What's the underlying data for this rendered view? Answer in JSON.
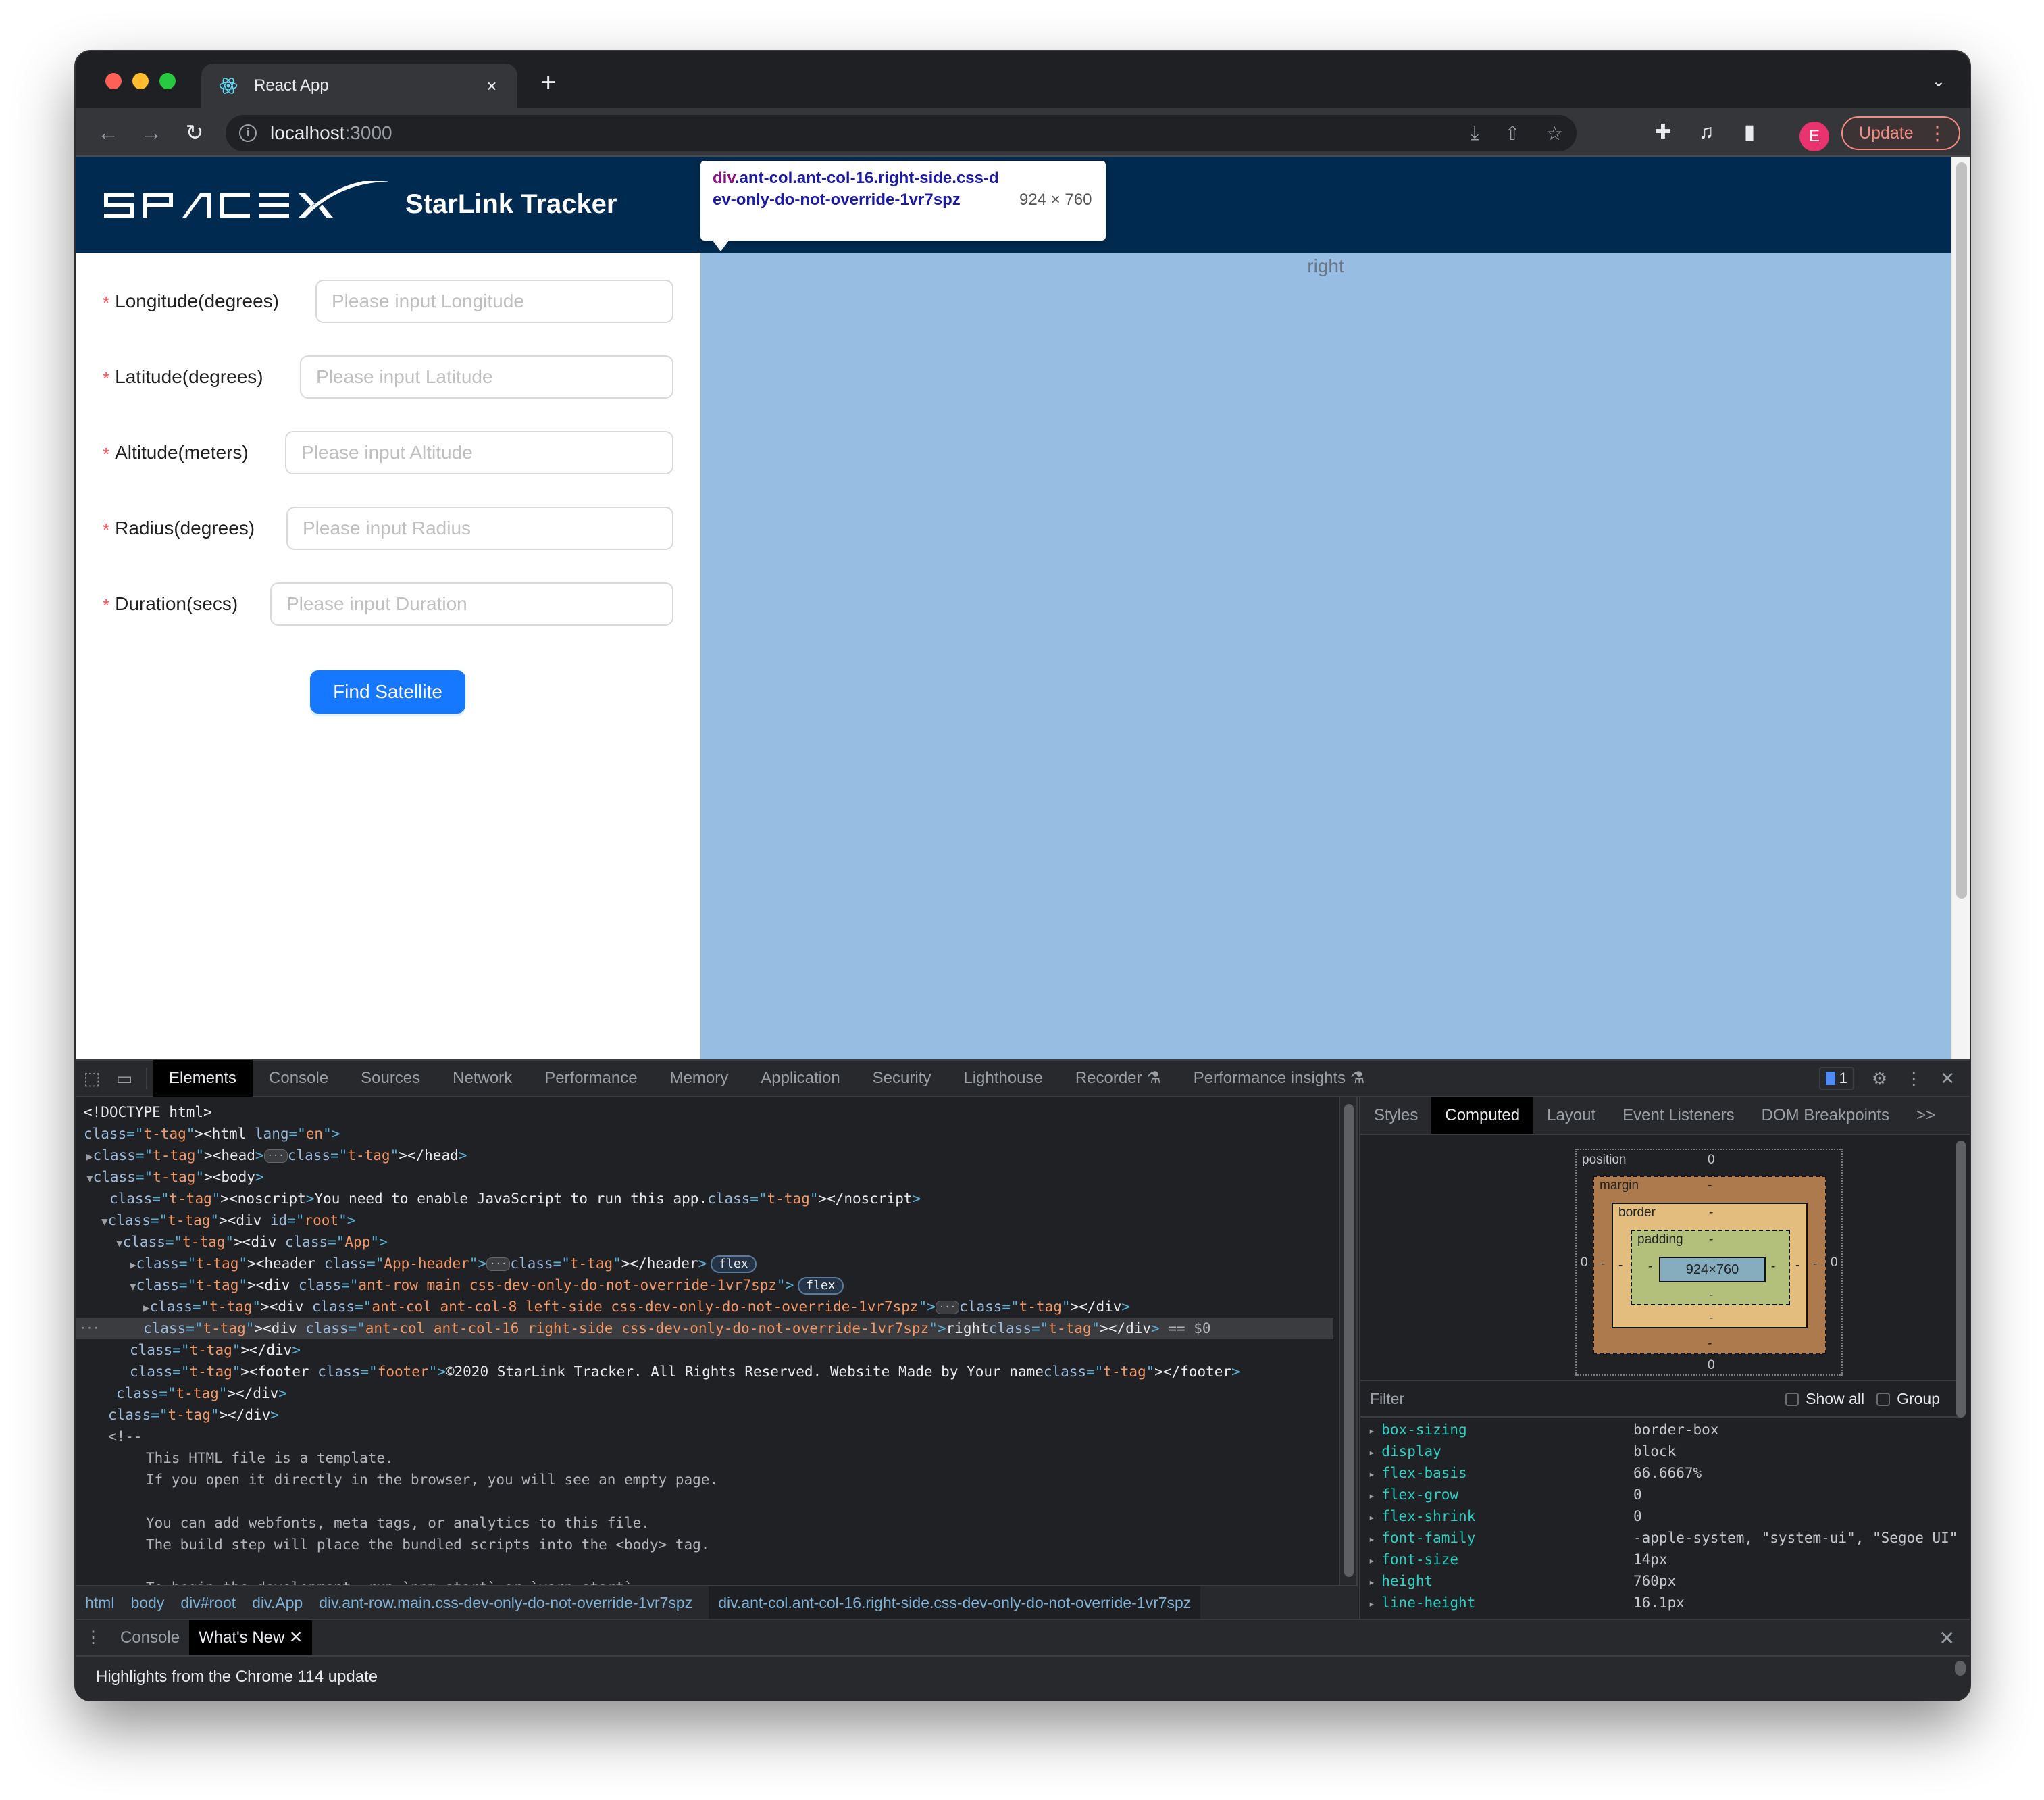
{
  "browser": {
    "tab_title": "React App",
    "tab_close": "×",
    "new_tab": "+",
    "url_host": "localhost",
    "url_port": ":3000",
    "profile_initial": "E",
    "update_label": "Update"
  },
  "app": {
    "logo_text": "SPACEX",
    "title": "StarLink Tracker",
    "form": [
      {
        "label": "Longitude(degrees)",
        "placeholder": "Please input Longitude",
        "required": true
      },
      {
        "label": "Latitude(degrees)",
        "placeholder": "Please input Latitude",
        "required": true
      },
      {
        "label": "Altitude(meters)",
        "placeholder": "Please input Altitude",
        "required": true
      },
      {
        "label": "Radius(degrees)",
        "placeholder": "Please input Radius",
        "required": true
      },
      {
        "label": "Duration(secs)",
        "placeholder": "Please input Duration",
        "required": true
      }
    ],
    "required_mark": "*",
    "submit_label": "Find Satellite",
    "right_text": "right",
    "colors": {
      "header_bg": "#002a4f",
      "right_bg": "#97bde2",
      "primary": "#1677ff"
    }
  },
  "inspector_tooltip": {
    "tag": "div",
    "classes": ".ant-col.ant-col-16.right-side.css-dev-only-do-not-override-1vr7spz",
    "size": "924 × 760"
  },
  "devtools": {
    "tabs": [
      "Elements",
      "Console",
      "Sources",
      "Network",
      "Performance",
      "Memory",
      "Application",
      "Security",
      "Lighthouse",
      "Recorder",
      "Performance insights"
    ],
    "active_tab": "Elements",
    "issues_count": "1",
    "elements_lines": [
      "<!DOCTYPE html>",
      "<html lang=\"en\">",
      "<head>…</head>",
      "<body>",
      "<noscript>You need to enable JavaScript to run this app.</noscript>",
      "<div id=\"root\">",
      "<div class=\"App\">",
      "<header class=\"App-header\">…</header>",
      "<div class=\"ant-row main css-dev-only-do-not-override-1vr7spz\">",
      "<div class=\"ant-col ant-col-8 left-side css-dev-only-do-not-override-1vr7spz\">…</div>",
      "<div class=\"ant-col ant-col-16 right-side css-dev-only-do-not-override-1vr7spz\">right</div>",
      "</div>",
      "<footer class=\"footer\">©2020 StarLink Tracker. All Rights Reserved. Website Made by Your name</footer>",
      "</div>",
      "</div>",
      "<!--",
      "This HTML file is a template.",
      "If you open it directly in the browser, you will see an empty page.",
      "",
      "You can add webfonts, meta tags, or analytics to this file.",
      "The build step will place the bundled scripts into the <body> tag.",
      "",
      "To begin the development, run `npm start` or `yarn start`."
    ],
    "selected_suffix": " == $0",
    "flex_badge": "flex",
    "breadcrumbs": [
      "html",
      "body",
      "div#root",
      "div.App",
      "div.ant-row.main.css-dev-only-do-not-override-1vr7spz",
      "div.ant-col.ant-col-16.right-side.css-dev-only-do-not-override-1vr7spz"
    ],
    "side_tabs": [
      "Styles",
      "Computed",
      "Layout",
      "Event Listeners",
      "DOM Breakpoints"
    ],
    "side_active": "Computed",
    "side_more": ">>",
    "box_model": {
      "position_label": "position",
      "position_top": "0",
      "position_right": "0",
      "position_bottom": "0",
      "position_left": "0",
      "margin_label": "margin",
      "border_label": "border",
      "padding_label": "padding",
      "dash": "-",
      "content": "924×760"
    },
    "filter_placeholder": "Filter",
    "show_all_label": "Show all",
    "group_label": "Group",
    "computed_props": [
      {
        "name": "box-sizing",
        "value": "border-box"
      },
      {
        "name": "display",
        "value": "block"
      },
      {
        "name": "flex-basis",
        "value": "66.6667%"
      },
      {
        "name": "flex-grow",
        "value": "0"
      },
      {
        "name": "flex-shrink",
        "value": "0"
      },
      {
        "name": "font-family",
        "value": "-apple-system, \"system-ui\", \"Segoe UI\""
      },
      {
        "name": "font-size",
        "value": "14px"
      },
      {
        "name": "height",
        "value": "760px"
      },
      {
        "name": "line-height",
        "value": "16.1px"
      }
    ],
    "drawer": {
      "tabs": [
        "Console",
        "What's New"
      ],
      "active": "What's New",
      "content": "Highlights from the Chrome 114 update"
    }
  }
}
